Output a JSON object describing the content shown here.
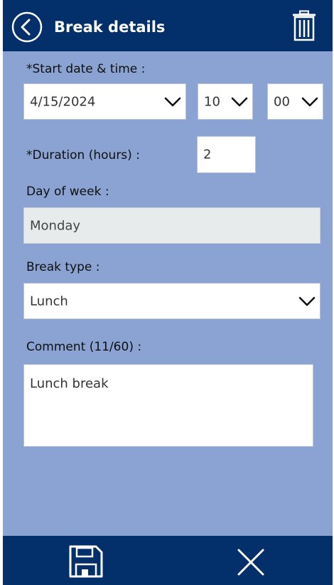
{
  "header": {
    "title": "Break details",
    "back_icon": "chevron-left-circle-icon",
    "delete_icon": "trash-icon"
  },
  "form": {
    "start": {
      "label": "*Start date & time :",
      "date": "4/15/2024",
      "hour": "10",
      "minute": "00"
    },
    "duration": {
      "label": "*Duration (hours) :",
      "value": "2"
    },
    "day_of_week": {
      "label": "Day of week :",
      "value": "Monday"
    },
    "break_type": {
      "label": "Break type :",
      "value": "Lunch"
    },
    "comment": {
      "label": "Comment (11/60) :",
      "value": "Lunch break"
    }
  },
  "footer": {
    "save_icon": "floppy-disk-icon",
    "close_icon": "close-icon"
  },
  "colors": {
    "header_bg": "#03306a",
    "body_bg": "#8aa3d3",
    "readonly_bg": "#e7ebec"
  }
}
